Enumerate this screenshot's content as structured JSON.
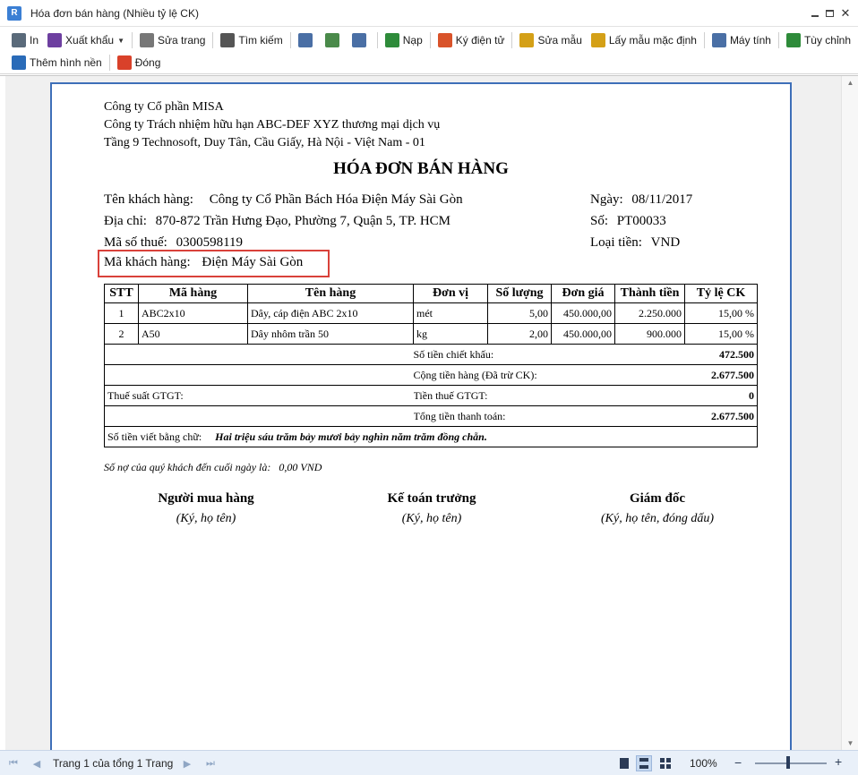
{
  "window": {
    "title": "Hóa đơn bán hàng (Nhiều tỷ lệ CK)"
  },
  "toolbar": {
    "row1": [
      {
        "id": "print",
        "label": "In",
        "icon": "printer-icon",
        "color": "#5a6a7a"
      },
      {
        "id": "export",
        "label": "Xuất khẩu",
        "icon": "save-disk-icon",
        "color": "#6d3fa0"
      },
      {
        "id": "edit-page",
        "label": "Sửa trang",
        "icon": "edit-page-icon",
        "color": "#777777"
      },
      {
        "id": "search",
        "label": "Tìm kiếm",
        "icon": "binoculars-icon",
        "color": "#555555"
      },
      {
        "id": "view1",
        "label": "",
        "icon": "single-page-icon",
        "color": "#4a6fa5"
      },
      {
        "id": "view2",
        "label": "",
        "icon": "page-width-icon",
        "color": "#4a8a4a"
      },
      {
        "id": "view3",
        "label": "",
        "icon": "multi-page-icon",
        "color": "#4a6fa5"
      },
      {
        "id": "reload",
        "label": "Nạp",
        "icon": "refresh-icon",
        "color": "#2e8b3a"
      },
      {
        "id": "sign",
        "label": "Ký điện tử",
        "icon": "signature-icon",
        "color": "#d9532a"
      },
      {
        "id": "edit-template",
        "label": "Sửa mẫu",
        "icon": "pencil-ruler-icon",
        "color": "#d4a017"
      },
      {
        "id": "default-template",
        "label": "Lấy mẫu mặc định",
        "icon": "pencil-ruler-icon",
        "color": "#d4a017"
      },
      {
        "id": "calculator",
        "label": "Máy tính",
        "icon": "calculator-icon",
        "color": "#4a6fa5"
      },
      {
        "id": "customize",
        "label": "Tùy chỉnh",
        "icon": "chart-customize-icon",
        "color": "#2e8b3a"
      }
    ],
    "row2": [
      {
        "id": "background",
        "label": "Thêm hình nền",
        "icon": "background-image-icon",
        "color": "#2a6bb8"
      },
      {
        "id": "close",
        "label": "Đóng",
        "icon": "close-power-icon",
        "color": "#d9412a"
      }
    ]
  },
  "report": {
    "company_lines": [
      "Công ty Cổ phần MISA",
      "Công ty Trách nhiệm hữu hạn ABC-DEF XYZ thương mại dịch vụ",
      "Tầng 9 Technosoft, Duy Tân, Cầu Giấy, Hà Nội - Việt Nam - 01"
    ],
    "title": "HÓA ĐƠN BÁN HÀNG",
    "customer_name_label": "Tên khách hàng:",
    "customer_name": "Công ty Cổ Phần Bách Hóa Điện Máy Sài Gòn",
    "address_label": "Địa chỉ:",
    "address": "870-872 Trần Hưng Đạo, Phường 7, Quận 5, TP. HCM",
    "tax_code_label": "Mã số thuế:",
    "tax_code": "0300598119",
    "customer_code_label": "Mã khách hàng:",
    "customer_code": "Điện Máy Sài Gòn",
    "date_label": "Ngày:",
    "date": "08/11/2017",
    "number_label": "Số:",
    "number": "PT00033",
    "currency_label": "Loại tiền:",
    "currency": "VND",
    "table": {
      "headers": [
        "STT",
        "Mã hàng",
        "Tên hàng",
        "Đơn vị",
        "Số lượng",
        "Đơn giá",
        "Thành tiền",
        "Tỷ lệ CK"
      ],
      "rows": [
        [
          "1",
          "ABC2x10",
          "Dây, cáp điện ABC 2x10",
          "mét",
          "5,00",
          "450.000,00",
          "2.250.000",
          "15,00 %"
        ],
        [
          "2",
          "A50",
          "Dây nhôm trần 50",
          "kg",
          "2,00",
          "450.000,00",
          "900.000",
          "15,00 %"
        ]
      ],
      "discount_label": "Số tiền chiết khấu:",
      "discount_value": "472.500",
      "subtotal_label": "Cộng tiền hàng (Đã trừ CK):",
      "subtotal_value": "2.677.500",
      "vat_rate_label": "Thuế suất GTGT:",
      "vat_amount_label": "Tiền thuế GTGT:",
      "vat_amount_value": "0",
      "total_label": "Tổng tiền thanh toán:",
      "total_value": "2.677.500",
      "words_label": "Số tiền viết bằng chữ:",
      "words_value": "Hai triệu sáu trăm bảy mươi bảy nghìn năm trăm đồng chẵn."
    },
    "debt_label": "Số nợ của quý khách đến cuối ngày là:",
    "debt_value": "0,00 VND",
    "signatures": [
      {
        "title": "Người mua hàng",
        "note": "(Ký, họ tên)"
      },
      {
        "title": "Kế toán trưởng",
        "note": "(Ký, họ tên)"
      },
      {
        "title": "Giám đốc",
        "note": "(Ký, họ tên, đóng dấu)"
      }
    ]
  },
  "statusbar": {
    "page_info": "Trang 1 của tổng 1 Trang",
    "zoom": "100%",
    "highlight_color": "#d9413a"
  }
}
